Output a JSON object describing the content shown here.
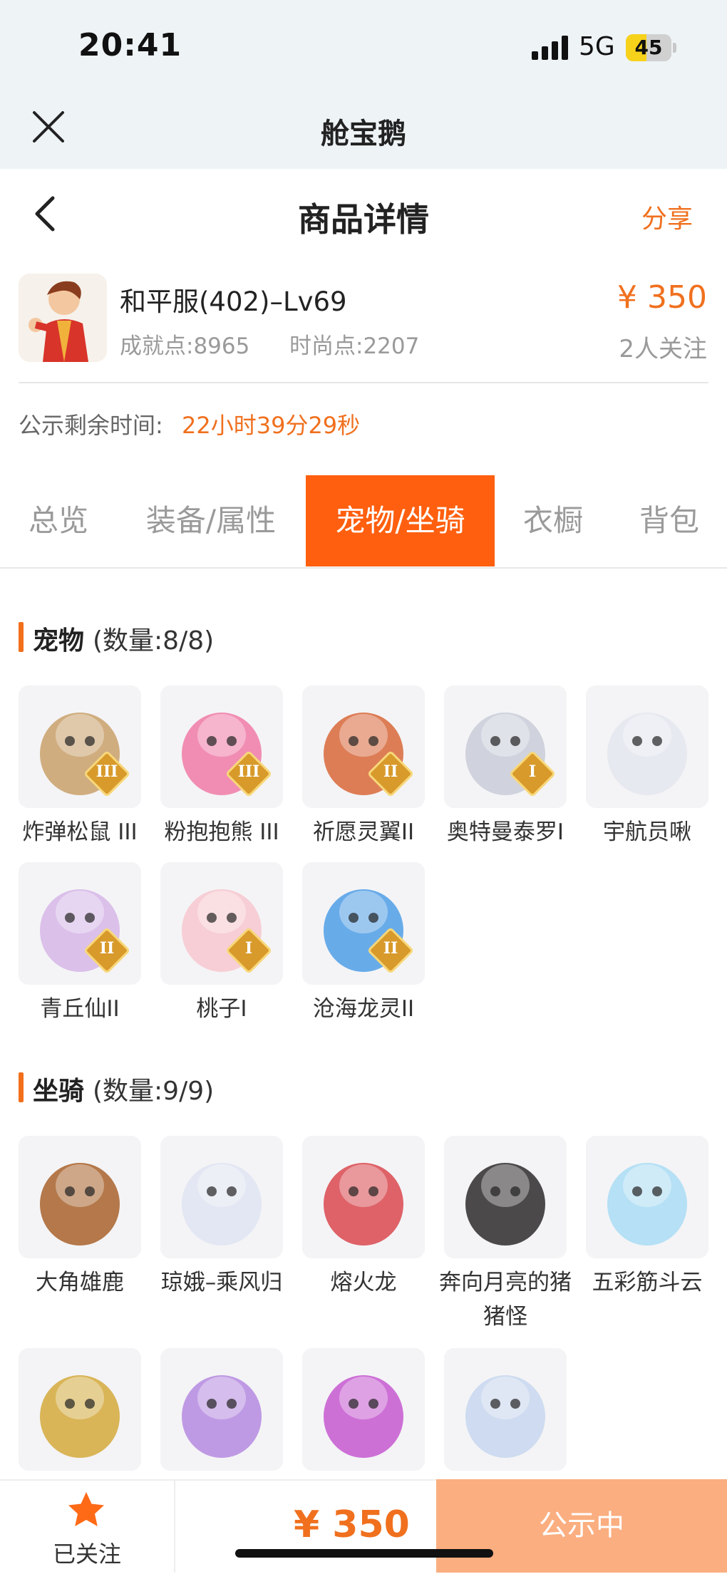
{
  "status_bar": {
    "time": "20:41",
    "network": "5G",
    "battery": "45",
    "battery_level": 0.45
  },
  "webview": {
    "title": "舱宝鹅"
  },
  "header": {
    "title": "商品详情",
    "share": "分享"
  },
  "product": {
    "server": "和平服(402)–Lv69",
    "achievement": "成就点:8965",
    "fashion": "时尚点:2207",
    "price": "¥ 350",
    "followers": "2人关注",
    "notice_label": "公示剩余时间:",
    "notice_time": "22小时39分29秒"
  },
  "tabs": [
    {
      "label": "总览",
      "active": false
    },
    {
      "label": "装备/属性",
      "active": false
    },
    {
      "label": "宠物/坐骑",
      "active": true
    },
    {
      "label": "衣橱",
      "active": false
    },
    {
      "label": "背包",
      "active": false
    }
  ],
  "pets": {
    "title": "宠物",
    "count": "(数量:8/8)",
    "items": [
      {
        "name": "炸弹松鼠 III",
        "rank": "III",
        "icon": "squirrel-icon",
        "color": "#c9a06a"
      },
      {
        "name": "粉抱抱熊 III",
        "rank": "III",
        "icon": "pink-bear-icon",
        "color": "#f07aa6"
      },
      {
        "name": "祈愿灵翼II",
        "rank": "II",
        "icon": "phoenix-icon",
        "color": "#d8673a"
      },
      {
        "name": "奥特曼泰罗I",
        "rank": "I",
        "icon": "ultraman-icon",
        "color": "#c9cdd8"
      },
      {
        "name": "宇航员啾",
        "rank": "",
        "icon": "astronaut-icon",
        "color": "#e4e6ee"
      },
      {
        "name": "青丘仙II",
        "rank": "II",
        "icon": "fox-fairy-icon",
        "color": "#d6b6e8"
      },
      {
        "name": "桃子I",
        "rank": "I",
        "icon": "peach-cat-icon",
        "color": "#f7c7cf"
      },
      {
        "name": "沧海龙灵II",
        "rank": "II",
        "icon": "dragon-spirit-icon",
        "color": "#4f9de6"
      }
    ]
  },
  "mounts": {
    "title": "坐骑",
    "count": "(数量:9/9)",
    "items": [
      {
        "name": "大角雄鹿",
        "icon": "deer-icon",
        "color": "#a8612c"
      },
      {
        "name": "琼娥–乘风归",
        "icon": "goddess-icon",
        "color": "#dfe4f2"
      },
      {
        "name": "熔火龙",
        "icon": "fire-dragon-icon",
        "color": "#d9484f"
      },
      {
        "name": "奔向月亮的猪猪怪",
        "icon": "pig-icon",
        "color": "#2e2a2b"
      },
      {
        "name": "五彩筋斗云",
        "icon": "cloud-icon",
        "color": "#a9dcf5"
      },
      {
        "name": "",
        "icon": "golden-beast-icon",
        "color": "#d4a93c"
      },
      {
        "name": "",
        "icon": "purple-dragon-icon",
        "color": "#b58ae0"
      },
      {
        "name": "",
        "icon": "heart-orb-icon",
        "color": "#c658d0"
      },
      {
        "name": "",
        "icon": "ice-horse-icon",
        "color": "#c7d6ef"
      }
    ]
  },
  "bottom_bar": {
    "follow_label": "已关注",
    "price": "¥ 350",
    "status": "公示中"
  }
}
